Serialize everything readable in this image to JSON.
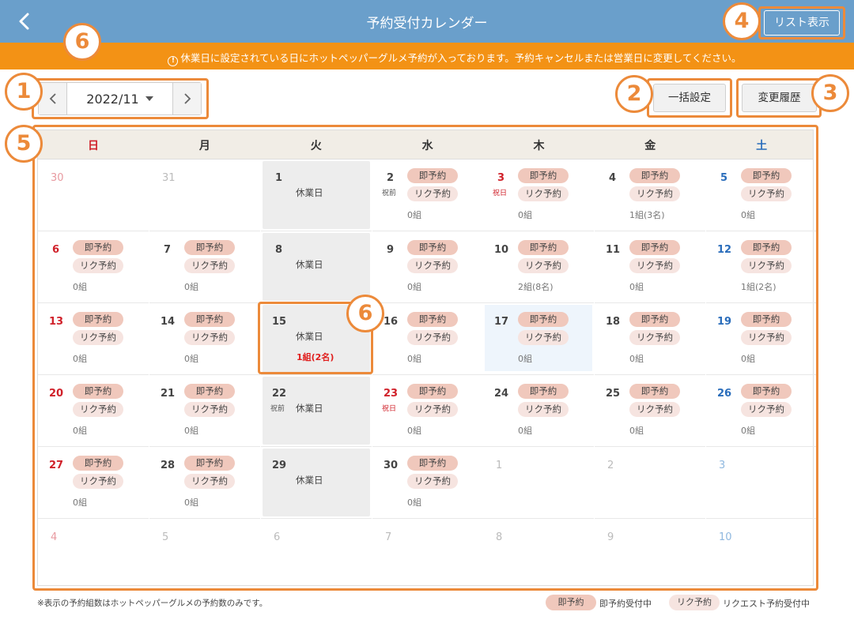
{
  "header": {
    "title": "予約受付カレンダー",
    "list_button": "リスト表示"
  },
  "warning": {
    "icon": "!",
    "message": "休業日に設定されている日にホットペッパーグルメ予約が入っております。予約キャンセルまたは営業日に変更してください。"
  },
  "toolbar": {
    "month": "2022/11",
    "bulk_button": "一括設定",
    "history_button": "変更履歴"
  },
  "weekdays": [
    "日",
    "月",
    "火",
    "水",
    "木",
    "金",
    "土"
  ],
  "pill_labels": {
    "sokuji": "即予約",
    "rikuest": "リク予約"
  },
  "closed_label": "休業日",
  "weeks": [
    [
      {
        "day": "30",
        "other": true
      },
      {
        "day": "31",
        "other": true
      },
      {
        "day": "1",
        "closed": true
      },
      {
        "day": "2",
        "sub": "祝前",
        "count": "0組"
      },
      {
        "day": "3",
        "sub": "祝日",
        "holiday": true,
        "count": "0組"
      },
      {
        "day": "4",
        "count": "1組(3名)"
      },
      {
        "day": "5",
        "count": "0組"
      }
    ],
    [
      {
        "day": "6",
        "count": "0組"
      },
      {
        "day": "7",
        "count": "0組"
      },
      {
        "day": "8",
        "closed": true
      },
      {
        "day": "9",
        "count": "0組"
      },
      {
        "day": "10",
        "count": "2組(8名)"
      },
      {
        "day": "11",
        "count": "0組"
      },
      {
        "day": "12",
        "count": "1組(2名)"
      }
    ],
    [
      {
        "day": "13",
        "count": "0組"
      },
      {
        "day": "14",
        "count": "0組"
      },
      {
        "day": "15",
        "closed": true,
        "alert": "1組(2名)"
      },
      {
        "day": "16",
        "count": "0組"
      },
      {
        "day": "17",
        "today": true,
        "count": "0組"
      },
      {
        "day": "18",
        "count": "0組"
      },
      {
        "day": "19",
        "count": "0組"
      }
    ],
    [
      {
        "day": "20",
        "count": "0組"
      },
      {
        "day": "21",
        "count": "0組"
      },
      {
        "day": "22",
        "sub": "祝前",
        "closed": true
      },
      {
        "day": "23",
        "sub": "祝日",
        "holiday": true,
        "count": "0組"
      },
      {
        "day": "24",
        "count": "0組"
      },
      {
        "day": "25",
        "count": "0組"
      },
      {
        "day": "26",
        "count": "0組"
      }
    ],
    [
      {
        "day": "27",
        "count": "0組"
      },
      {
        "day": "28",
        "count": "0組"
      },
      {
        "day": "29",
        "closed": true
      },
      {
        "day": "30",
        "count": "0組"
      },
      {
        "day": "1",
        "other": true
      },
      {
        "day": "2",
        "other": true
      },
      {
        "day": "3",
        "other": true
      }
    ],
    [
      {
        "day": "4",
        "other": true
      },
      {
        "day": "5",
        "other": true
      },
      {
        "day": "6",
        "other": true
      },
      {
        "day": "7",
        "other": true
      },
      {
        "day": "8",
        "other": true
      },
      {
        "day": "9",
        "other": true
      },
      {
        "day": "10",
        "other": true
      }
    ]
  ],
  "footer": {
    "note": "※表示の予約組数はホットペッパーグルメの予約数のみです。",
    "legend_sokuji": "即予約",
    "legend_sokuji_text": "即予約受付中",
    "legend_rikuest": "リク予約",
    "legend_rikuest_text": "リクエスト予約受付中"
  },
  "callouts": {
    "c1": "1",
    "c2": "2",
    "c3": "3",
    "c4": "4",
    "c5": "5",
    "c6a": "6",
    "c6b": "6"
  },
  "colors": {
    "header": "#6a9fcb",
    "warning": "#f39215",
    "callout": "#ec8a3a",
    "sunday": "#d0212a",
    "saturday": "#2a6dbb"
  }
}
